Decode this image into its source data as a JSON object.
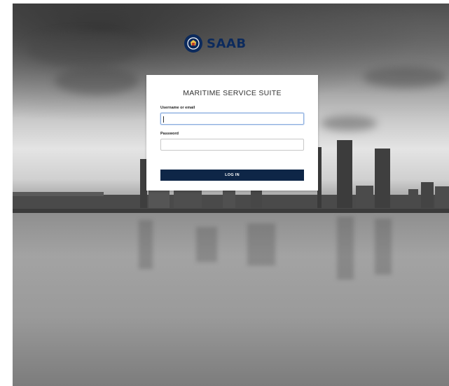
{
  "brand": {
    "name": "SAAB",
    "icon": "saab-crown-emblem-icon",
    "color": "#0c2a5c"
  },
  "login": {
    "title": "MARITIME SERVICE SUITE",
    "username_label": "Username or email",
    "username_value": "",
    "password_label": "Password",
    "password_value": "",
    "submit_label": "LOG IN",
    "button_color": "#0e2647"
  },
  "background": {
    "description_icon": "city-waterfront-photo"
  }
}
